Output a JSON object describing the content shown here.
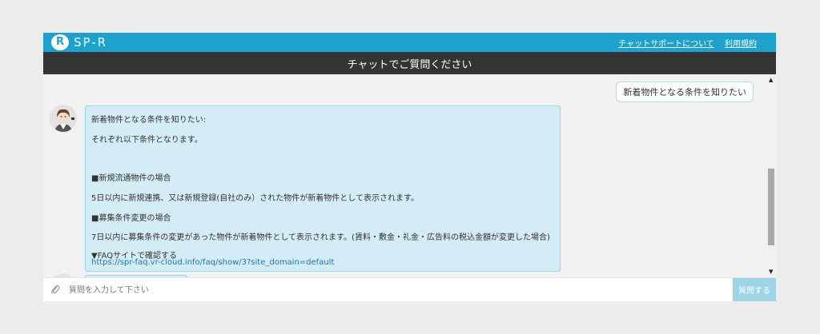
{
  "header": {
    "logo_text": "SP-R",
    "links": [
      "チャットサポートについて",
      "利用規約"
    ]
  },
  "title": "チャットでご質問ください",
  "messages": {
    "user": "新着物件となる条件を知りたい",
    "bot": {
      "lines": [
        "新着物件となる条件を知りたい:",
        "それぞれ以下条件となります。",
        "■新規流通物件の場合",
        "5日以内に新規連携、又は新規登録(自社のみ）された物件が新着物件として表示されます。",
        "■募集条件変更の場合",
        "7日以内に募集条件の変更があった物件が新着物件として表示されます。(賃料・敷金・礼金・広告料の税込金額が変更した場合)",
        "▼FAQサイトで確認する"
      ],
      "link": "https://spr-faq.vr-cloud.info/faq/show/3?site_domain=default"
    }
  },
  "composer": {
    "placeholder": "質問を入力して下さい",
    "value": "",
    "send_label": "質問する"
  },
  "icons": [
    "logo-icon",
    "avatar-icon",
    "paperclip-icon",
    "scroll-up-icon",
    "scroll-down-icon"
  ],
  "colors": {
    "header_bg": "#1ea2cd",
    "title_bg": "#343434",
    "bubble_bg": "#d3ecf6",
    "bubble_border": "#9dd3e6",
    "send_button": "#9fd4e8",
    "link": "#1b78b4"
  }
}
